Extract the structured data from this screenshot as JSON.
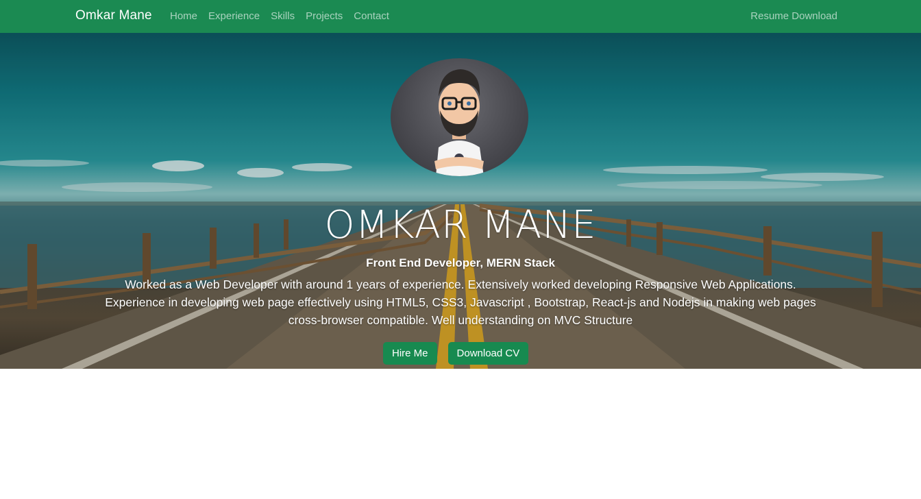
{
  "nav": {
    "brand": "Omkar Mane",
    "links": [
      "Home",
      "Experience",
      "Skills",
      "Projects",
      "Contact"
    ],
    "right_link": "Resume Download"
  },
  "hero": {
    "name": "OMKAR MANE",
    "subtitle": "Front End Developer, MERN Stack",
    "description_lines": [
      "Worked as a Web Developer with around 1 years of experience. Extensively worked developing Responsive Web Applications.",
      "Experience in developing web page effectively using HTML5, CSS3, Javascript , Bootstrap, React-js and Nodejs in making web pages",
      "cross-browser compatible. Well understanding on MVC Structure"
    ],
    "buttons": {
      "hire": "Hire Me",
      "download": "Download CV"
    },
    "avatar_icon": "memoji-avatar-icon"
  },
  "colors": {
    "navbar": "#1b8a52",
    "button": "#178a50",
    "text_light": "#ffffff"
  }
}
